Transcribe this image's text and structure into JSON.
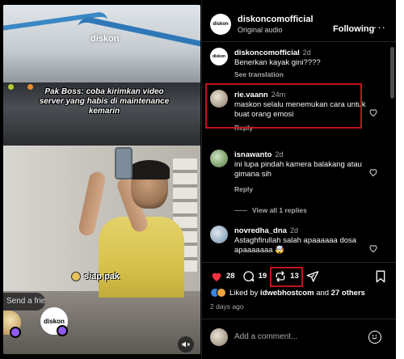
{
  "video": {
    "watermark": "diskon",
    "caption": "Pak Boss: coba kirimkan video server yang habis di maintenance kemarin",
    "reply_text": "siap pak",
    "send_message_placeholder": "Send a friend...",
    "bubble_label": "diskon"
  },
  "header": {
    "account_name": "diskoncomofficial",
    "audio": "Original audio",
    "following_label": "Following",
    "more_label": "···"
  },
  "comments": [
    {
      "username": "diskoncomofficial",
      "time": "2d",
      "text": "Benerkan kayak gini????",
      "secondary": "See translation",
      "avatar": "diskon"
    },
    {
      "username": "rie.vaann",
      "time": "24m",
      "text": "maskon selalu menemukan cara untuk buat orang emosi",
      "secondary": "Reply"
    },
    {
      "username": "isnawanto",
      "time": "2d",
      "text": "ini lupa pindah kamera balakang atau gimana sih",
      "secondary": "Reply"
    },
    {
      "username": "novredha_dna",
      "time": "2d",
      "text": "Astaghfirullah salah apaaaaaa dosa apaaaaaaa 🤯"
    }
  ],
  "view_replies": "View all 1 replies",
  "actions": {
    "likes": "28",
    "comments": "19",
    "reposts": "13"
  },
  "liked_by": {
    "prefix": "Liked by",
    "user": "idwebhostcom",
    "middle": "and",
    "others": "27 others"
  },
  "posted_ago": "2 days ago",
  "add_comment_placeholder": "Add a comment...",
  "colors": {
    "like_red": "#ff3040",
    "highlight_box": "#c0141a",
    "badge_purple": "#8e5cf0"
  }
}
